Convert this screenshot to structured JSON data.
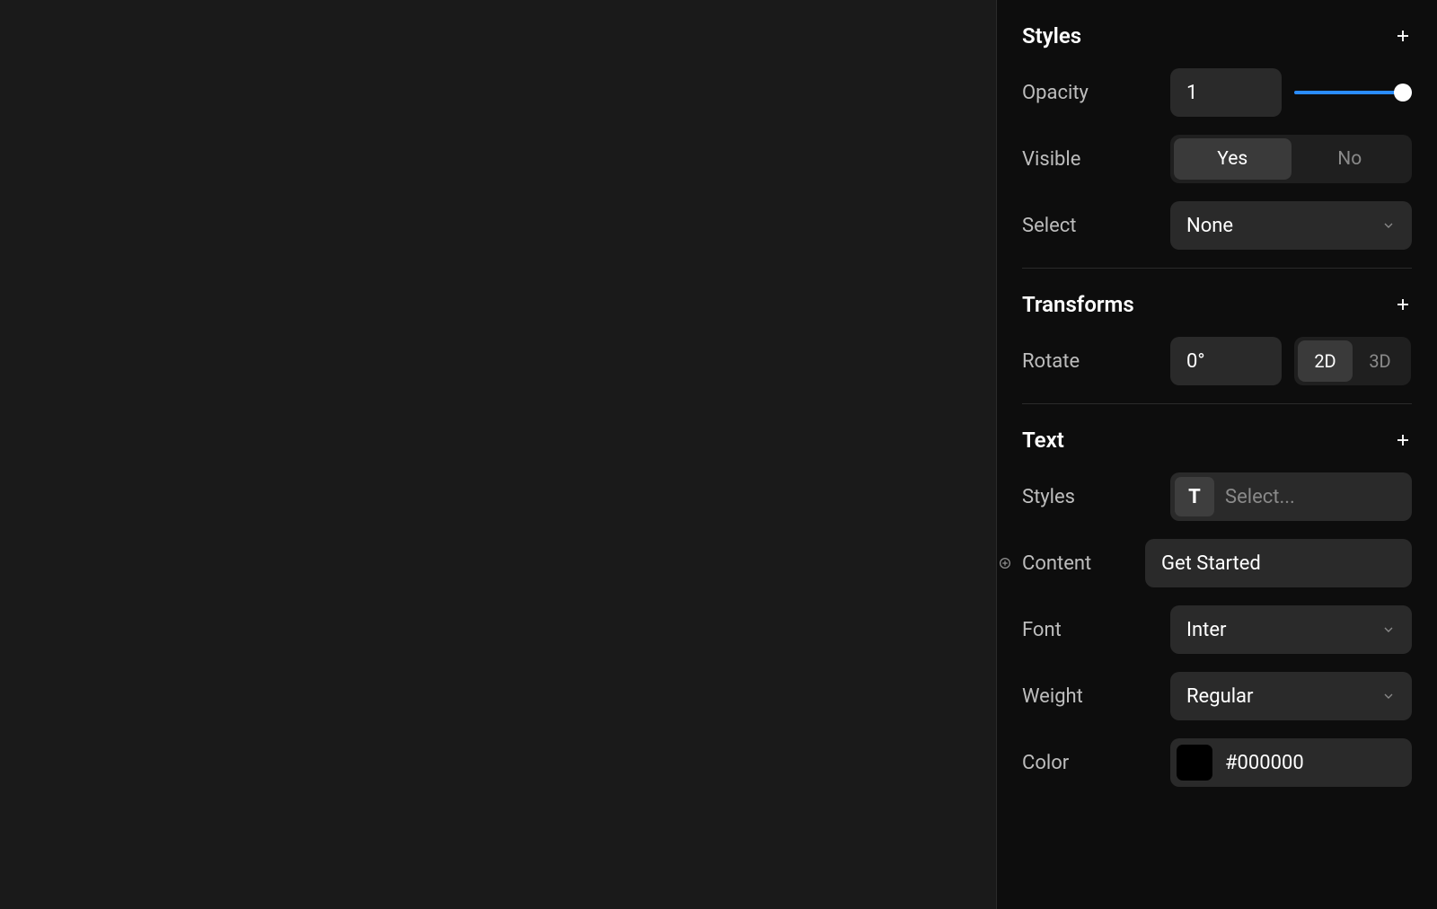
{
  "sections": {
    "styles": {
      "title": "Styles",
      "opacity": {
        "label": "Opacity",
        "value": "1"
      },
      "visible": {
        "label": "Visible",
        "yes": "Yes",
        "no": "No"
      },
      "select": {
        "label": "Select",
        "value": "None"
      }
    },
    "transforms": {
      "title": "Transforms",
      "rotate": {
        "label": "Rotate",
        "value": "0°",
        "mode2d": "2D",
        "mode3d": "3D"
      }
    },
    "text": {
      "title": "Text",
      "styles": {
        "label": "Styles",
        "glyph": "T",
        "placeholder": "Select..."
      },
      "content": {
        "label": "Content",
        "value": "Get Started"
      },
      "font": {
        "label": "Font",
        "value": "Inter"
      },
      "weight": {
        "label": "Weight",
        "value": "Regular"
      },
      "color": {
        "label": "Color",
        "value": "#000000",
        "swatch": "#000000"
      }
    }
  }
}
